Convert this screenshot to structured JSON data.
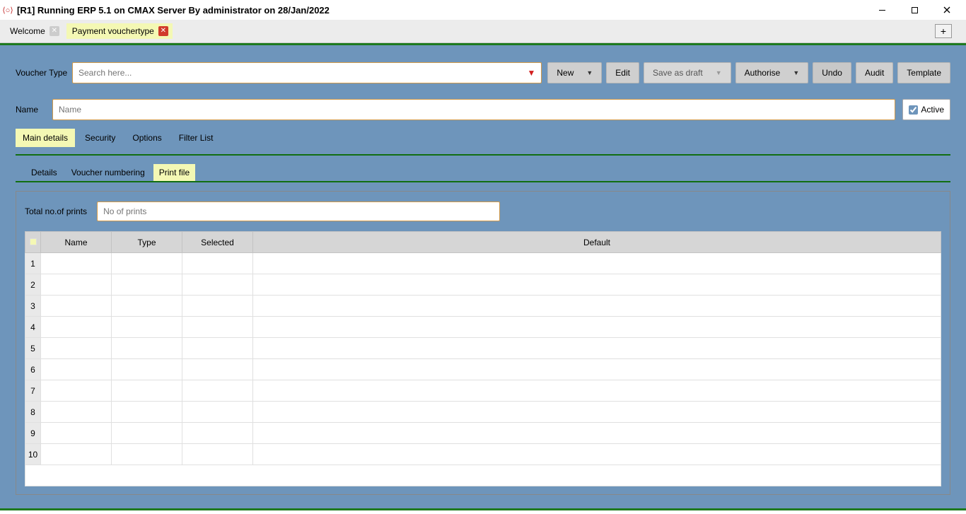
{
  "window": {
    "title": "[R1] Running ERP 5.1 on CMAX Server By administrator on 28/Jan/2022"
  },
  "doc_tabs": {
    "welcome": "Welcome",
    "payment": "Payment vouchertype",
    "add": "+"
  },
  "voucher": {
    "label": "Voucher Type",
    "search_placeholder": "Search here..."
  },
  "actions": {
    "new": "New",
    "edit": "Edit",
    "save_as_draft": "Save as draft",
    "authorise": "Authorise",
    "undo": "Undo",
    "audit": "Audit",
    "template": "Template"
  },
  "name": {
    "label": "Name",
    "placeholder": "Name",
    "active": "Active"
  },
  "section_tabs": {
    "main": "Main details",
    "security": "Security",
    "options": "Options",
    "filter_list": "Filter List"
  },
  "subtabs": {
    "details": "Details",
    "voucher_numbering": "Voucher numbering",
    "print_file": "Print file"
  },
  "panel": {
    "total_prints_label": "Total no.of prints",
    "total_prints_placeholder": "No of prints"
  },
  "table": {
    "headers": {
      "name": "Name",
      "type": "Type",
      "selected": "Selected",
      "default": "Default"
    },
    "rows": [
      "1",
      "2",
      "3",
      "4",
      "5",
      "6",
      "7",
      "8",
      "9",
      "10"
    ]
  }
}
